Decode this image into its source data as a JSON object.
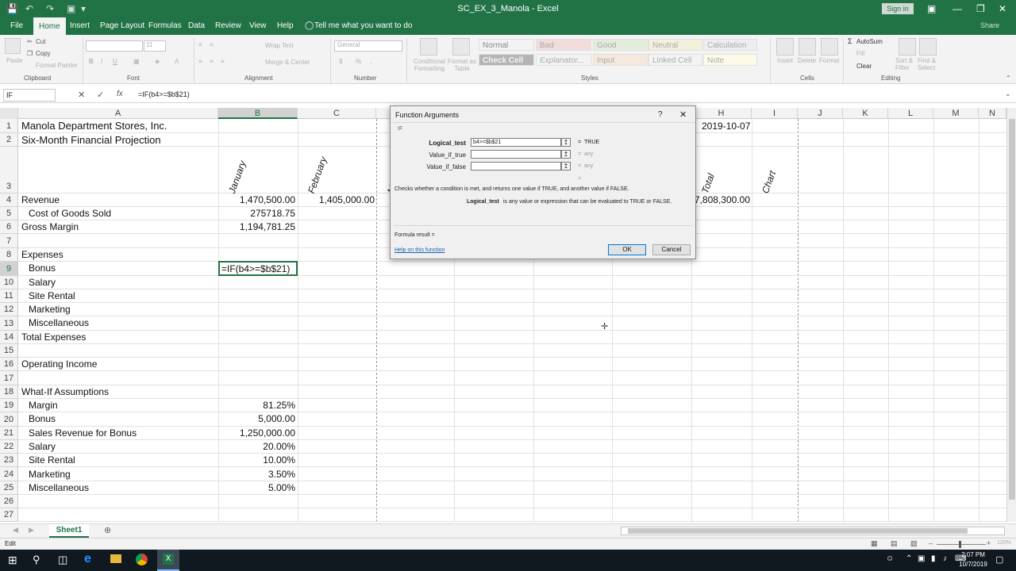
{
  "window": {
    "title": "SC_EX_3_Manola - Excel",
    "signin": "Sign in",
    "share": "Share"
  },
  "tabs": [
    "File",
    "Home",
    "Insert",
    "Page Layout",
    "Formulas",
    "Data",
    "Review",
    "View",
    "Help",
    "Tell me what you want to do"
  ],
  "ribbon": {
    "clipboard": {
      "paste": "Paste",
      "cut": "Cut",
      "copy": "Copy",
      "format_painter": "Format Painter",
      "label": "Clipboard"
    },
    "font": {
      "size": "11",
      "label": "Font"
    },
    "alignment": {
      "wrap": "Wrap Text",
      "merge": "Merge & Center",
      "label": "Alignment"
    },
    "number": {
      "format": "General",
      "label": "Number"
    },
    "styles": {
      "conditional": "Conditional Formatting",
      "format_table": "Format as Table",
      "cells": [
        "Normal",
        "Bad",
        "Good",
        "Neutral",
        "Calculation",
        "Check Cell",
        "Explanator...",
        "Input",
        "Linked Cell",
        "Note"
      ],
      "label": "Styles"
    },
    "cells": {
      "insert": "Insert",
      "delete": "Delete",
      "format": "Format",
      "label": "Cells"
    },
    "editing": {
      "autosum": "AutoSum",
      "fill": "Fill",
      "clear": "Clear",
      "sort": "Sort & Filter",
      "find": "Find & Select",
      "label": "Editing"
    }
  },
  "formula_bar": {
    "name_box": "IF",
    "fx": "fx",
    "formula": "=IF(b4>=$b$21)"
  },
  "columns": [
    "A",
    "B",
    "C",
    "D",
    "E",
    "F",
    "G",
    "H",
    "I",
    "J",
    "K",
    "L",
    "M",
    "N"
  ],
  "rows": [
    "1",
    "2",
    "3",
    "4",
    "5",
    "6",
    "7",
    "8",
    "9",
    "10",
    "11",
    "12",
    "13",
    "14",
    "15",
    "16",
    "17",
    "18",
    "19",
    "20",
    "21",
    "22",
    "23",
    "24",
    "25",
    "26",
    "27"
  ],
  "sheet": {
    "a1": "Manola Department Stores, Inc.",
    "a2": "Six-Month Financial Projection",
    "headers": [
      "January",
      "February",
      "March",
      "Total",
      "Chart"
    ],
    "h1": "2019-10-07",
    "a4": "Revenue",
    "b4": "1,470,500.00",
    "c4": "1,405,000.00",
    "h4": "7,808,300.00",
    "a5": "Cost of Goods Sold",
    "b5": "275718.75",
    "a6": "Gross Margin",
    "b6": "1,194,781.25",
    "a8": "Expenses",
    "a9": "Bonus",
    "b9": "=IF(b4>=$b$21)",
    "a10": "Salary",
    "a11": "Site Rental",
    "a12": "Marketing",
    "a13": "Miscellaneous",
    "a14": "Total Expenses",
    "a16": "Operating Income",
    "a18": "What-If Assumptions",
    "a19": "Margin",
    "b19": "81.25%",
    "a20": "Bonus",
    "b20": "5,000.00",
    "a21": "Sales Revenue for Bonus",
    "b21": "1,250,000.00",
    "a22": "Salary",
    "b22": "20.00%",
    "a23": "Site Rental",
    "b23": "10.00%",
    "a24": "Marketing",
    "b24": "3.50%",
    "a25": "Miscellaneous",
    "b25": "5.00%"
  },
  "dialog": {
    "title": "Function Arguments",
    "help_q": "?",
    "func": "IF",
    "args": [
      {
        "label": "Logical_test",
        "value": "b4>=$b$21",
        "result": "TRUE"
      },
      {
        "label": "Value_if_true",
        "value": "",
        "result": "any"
      },
      {
        "label": "Value_if_false",
        "value": "",
        "result": "any"
      }
    ],
    "equals": "=",
    "description": "Checks whether a condition is met, and returns one value if TRUE, and another value if FALSE.",
    "arg_help_name": "Logical_test",
    "arg_help": "is any value or expression that can be evaluated to TRUE or FALSE.",
    "formula_result": "Formula result =",
    "help_link": "Help on this function",
    "ok": "OK",
    "cancel": "Cancel"
  },
  "sheet_tab": "Sheet1",
  "status": {
    "mode": "Edit",
    "zoom": "120%"
  },
  "taskbar": {
    "time": "2:07 PM",
    "date": "10/7/2019"
  }
}
